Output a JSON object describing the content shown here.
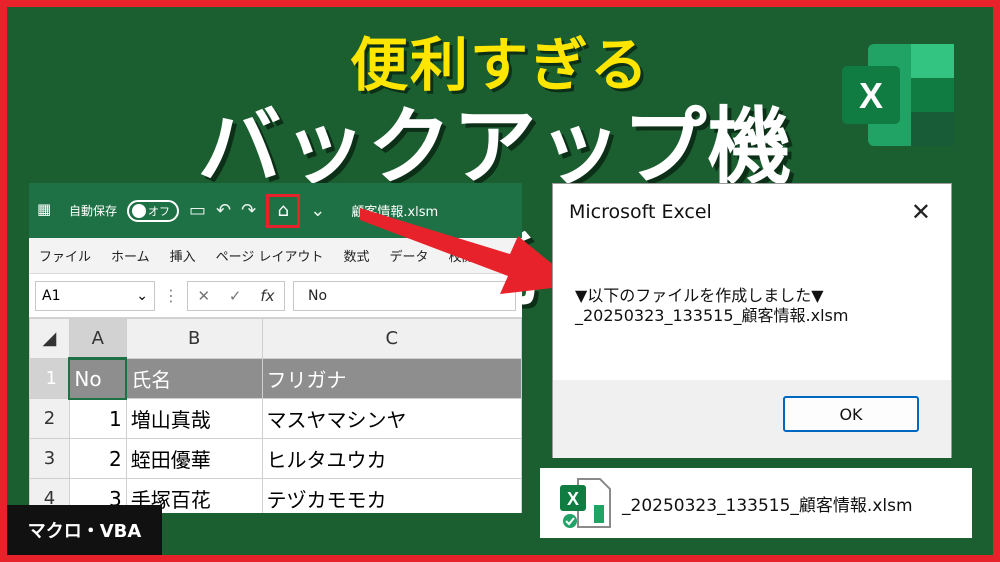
{
  "headline": {
    "line1": "便利すぎる",
    "line2": "バックアップ機能"
  },
  "logo": {
    "letter": "X"
  },
  "excel": {
    "app_icon": "office-icon",
    "autosave_label": "自動保存",
    "toggle_label": "オフ",
    "filename": "顧客情報.xlsm",
    "ribbon_tabs": [
      "ファイル",
      "ホーム",
      "挿入",
      "ページ レイアウト",
      "数式",
      "データ",
      "校閲"
    ],
    "namebox_value": "A1",
    "fx_label": "fx",
    "formula_value": "No",
    "columns": [
      "A",
      "B",
      "C"
    ],
    "rows": [
      {
        "num": "1",
        "a": "No",
        "b": "氏名",
        "c": "フリガナ"
      },
      {
        "num": "2",
        "a": "1",
        "b": "増山真哉",
        "c": "マスヤマシンヤ"
      },
      {
        "num": "3",
        "a": "2",
        "b": "蛭田優華",
        "c": "ヒルタユウカ"
      },
      {
        "num": "4",
        "a": "3",
        "b": "手塚百花",
        "c": "テヅカモモカ"
      }
    ]
  },
  "dialog": {
    "title": "Microsoft Excel",
    "close_glyph": "✕",
    "line1": "▼以下のファイルを作成しました▼",
    "line2": "_20250323_133515_顧客情報.xlsm",
    "ok_label": "OK"
  },
  "file_chip": {
    "name": "_20250323_133515_顧客情報.xlsm",
    "icon": "excel-file-icon"
  },
  "badge": {
    "label": "マクロ・VBA"
  },
  "colors": {
    "background": "#1b5e30",
    "border": "#e8222a",
    "excel_green": "#1e7145",
    "headline_yellow": "#ffe600"
  }
}
